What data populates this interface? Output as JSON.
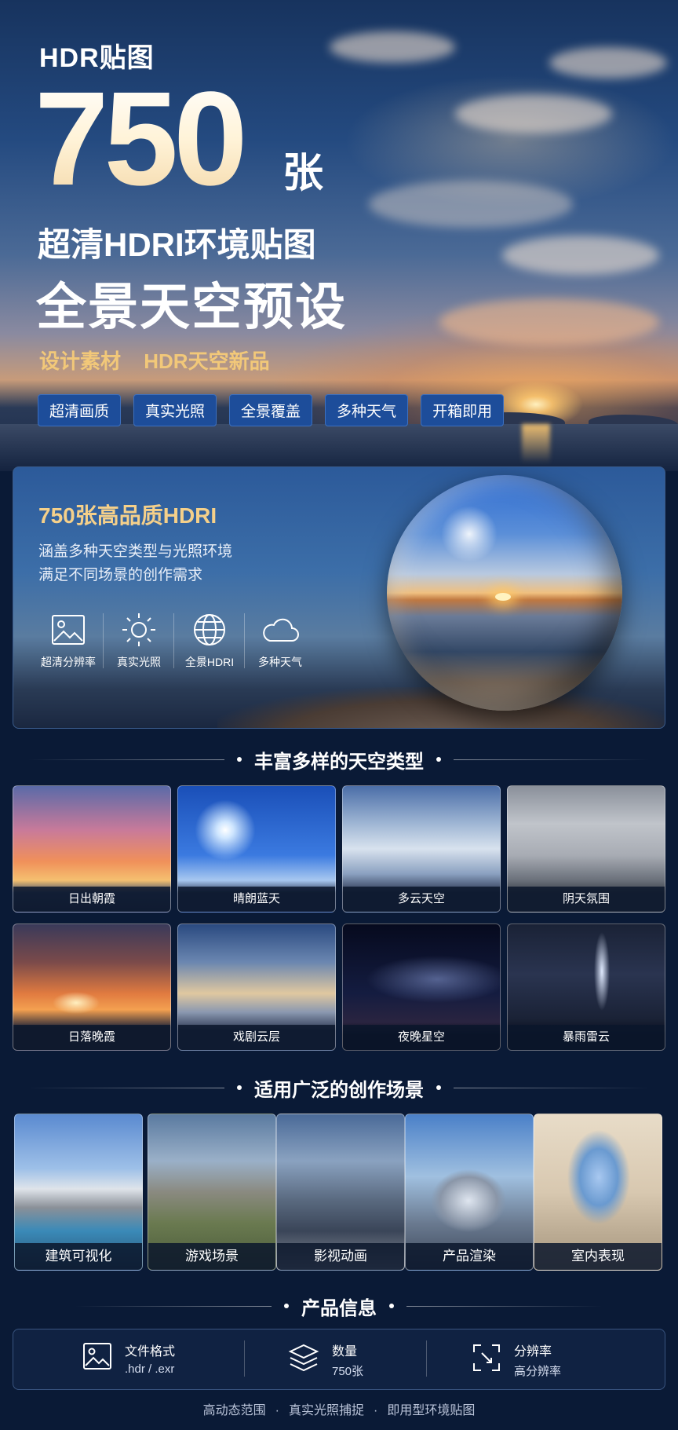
{
  "hero": {
    "hdr_label": "HDR贴图",
    "big_number": "750",
    "big_unit": "张",
    "subtitle1": "超清HDRI环境贴图",
    "subtitle2": "全景天空预设",
    "gold_left": "设计素材",
    "gold_right": "HDR天空新品",
    "tags": [
      "超清画质",
      "真实光照",
      "全景覆盖",
      "多种天气",
      "开箱即用"
    ]
  },
  "card": {
    "title": "750张高品质HDRI",
    "line1": "涵盖多种天空类型与光照环境",
    "line2": "满足不同场景的创作需求",
    "features": [
      {
        "icon": "image-icon",
        "label": "超清分辨率"
      },
      {
        "icon": "sun-icon",
        "label": "真实光照"
      },
      {
        "icon": "globe-icon",
        "label": "全景HDRI"
      },
      {
        "icon": "cloud-icon",
        "label": "多种天气"
      }
    ]
  },
  "sky_section": {
    "title": "丰富多样的天空类型",
    "items": [
      "日出朝霞",
      "晴朗蓝天",
      "多云天空",
      "阴天氛围",
      "日落晚霞",
      "戏剧云层",
      "夜晚星空",
      "暴雨雷云"
    ]
  },
  "scene_section": {
    "title": "适用广泛的创作场景",
    "items": [
      "建筑可视化",
      "游戏场景",
      "影视动画",
      "产品渲染",
      "室内表现"
    ]
  },
  "info_section": {
    "title": "产品信息",
    "items": [
      {
        "icon": "file-image-icon",
        "key": "文件格式",
        "value": ".hdr / .exr"
      },
      {
        "icon": "layers-icon",
        "key": "数量",
        "value": "750张"
      },
      {
        "icon": "resolution-icon",
        "key": "分辨率",
        "value": "高分辨率"
      }
    ]
  },
  "footer": {
    "items": [
      "高动态范围",
      "真实光照捕捉",
      "即用型环境贴图"
    ]
  }
}
